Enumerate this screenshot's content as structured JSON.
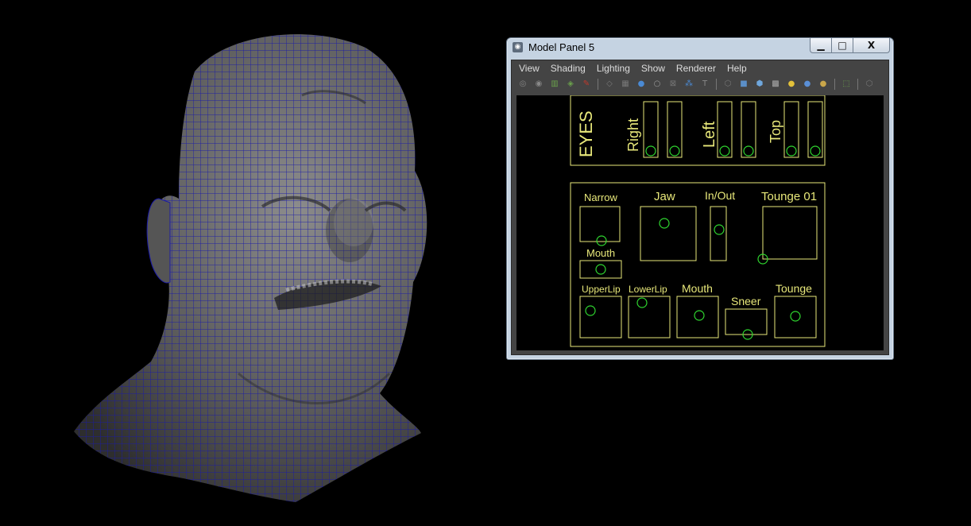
{
  "window": {
    "title": "Model Panel 5",
    "app_icon": "maya-icon",
    "minimize_glyph": "▁",
    "maximize_glyph": "□",
    "close_glyph": "X"
  },
  "menu": [
    "View",
    "Shading",
    "Lighting",
    "Show",
    "Renderer",
    "Help"
  ],
  "toolbar_icons": [
    {
      "name": "select-camera-icon",
      "glyph": "◎",
      "color": "#888"
    },
    {
      "name": "lock-camera-icon",
      "glyph": "◉",
      "color": "#888"
    },
    {
      "name": "bookmarks-icon",
      "glyph": "▥",
      "color": "#6aa04c"
    },
    {
      "name": "image-plane-icon",
      "glyph": "◈",
      "color": "#6aa04c"
    },
    {
      "name": "two-d-pan-icon",
      "glyph": "✎",
      "color": "#c0392b"
    },
    {
      "sep": true
    },
    {
      "name": "grid-icon",
      "glyph": "◇",
      "color": "#777"
    },
    {
      "name": "film-gate-icon",
      "glyph": "▦",
      "color": "#777"
    },
    {
      "name": "resolution-gate-icon",
      "glyph": "●",
      "color": "#4a8ad4"
    },
    {
      "name": "gate-mask-icon",
      "glyph": "○",
      "color": "#999"
    },
    {
      "name": "field-chart-icon",
      "glyph": "⊠",
      "color": "#777"
    },
    {
      "name": "safe-action-icon",
      "glyph": "⁂",
      "color": "#4a8ad4"
    },
    {
      "name": "safe-title-icon",
      "glyph": "T",
      "color": "#888"
    },
    {
      "sep": true
    },
    {
      "name": "wireframe-icon",
      "glyph": "⬡",
      "color": "#777"
    },
    {
      "name": "smooth-shade-icon",
      "glyph": "■",
      "color": "#5b8fc8"
    },
    {
      "name": "wireframe-on-shaded-icon",
      "glyph": "⬢",
      "color": "#6fa7dd"
    },
    {
      "name": "textured-icon",
      "glyph": "▩",
      "color": "#aaa"
    },
    {
      "name": "use-all-lights-icon",
      "glyph": "●",
      "color": "#e3c13a"
    },
    {
      "name": "shadows-icon",
      "glyph": "●",
      "color": "#5a8fd6"
    },
    {
      "name": "high-quality-icon",
      "glyph": "●",
      "color": "#c9a64a"
    },
    {
      "sep": true
    },
    {
      "name": "isolate-select-icon",
      "glyph": "⬚",
      "color": "#6aa04c"
    },
    {
      "sep": true
    },
    {
      "name": "xray-icon",
      "glyph": "⬡",
      "color": "#777"
    }
  ],
  "rig": {
    "eyes_title": "EYES",
    "eyes_labels": [
      "Right",
      "Left",
      "Top"
    ],
    "mouth_labels": {
      "narrow": "Narrow",
      "jaw": "Jaw",
      "in_out": "In/Out",
      "tounge01": "Tounge 01",
      "mouth_small": "Mouth",
      "upperlip": "UpperLip",
      "lowerlip": "LowerLip",
      "mouth": "Mouth",
      "sneer": "Sneer",
      "tounge": "Tounge"
    },
    "line_color": "#e8e87a",
    "handle_color": "#2fd62f"
  },
  "mesh": {
    "surface_color": "#5a5a5a",
    "wire_color": "#1a1aa8"
  }
}
